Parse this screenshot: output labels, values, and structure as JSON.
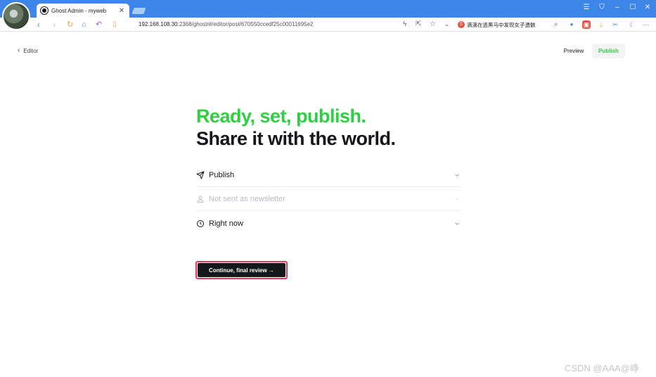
{
  "browser": {
    "tab_title": "Ghost Admin - myweb",
    "tab_close": "✕",
    "address_host": "192.168.108.30",
    "address_rest": ":2368/ghost/#/editor/post/670550ccedf25c00011695e2",
    "search_text": "滴滴在逃黑马中发现女子遗骸",
    "window_controls": [
      "☰",
      "⛉",
      "–",
      "☐",
      "✕"
    ],
    "icons": [
      "back-icon",
      "forward-icon",
      "refresh-icon",
      "home-icon",
      "undo-icon",
      "reader-icon",
      "lightning-icon",
      "share-icon",
      "star-icon",
      "chevron-down-icon",
      "search-icon",
      "more-icon"
    ]
  },
  "page": {
    "back_label": "Editor",
    "preview_label": "Preview",
    "publish_label": "Publish",
    "heading_line1": "Ready, set, publish.",
    "heading_line2": "Share it with the world.",
    "options": [
      {
        "label": "Publish",
        "icon": "send-icon",
        "disabled": false
      },
      {
        "label": "Not sent as newsletter",
        "icon": "user-icon",
        "disabled": true
      },
      {
        "label": "Right now",
        "icon": "clock-icon",
        "disabled": false
      }
    ],
    "continue_label": "Continue, final review →",
    "colors": {
      "accent_green": "#30cf43",
      "primary_dark": "#15171a",
      "highlight_border": "#e23b5a",
      "browser_blue": "#3d86e8"
    }
  },
  "watermark": "CSDN @AAA@峥"
}
